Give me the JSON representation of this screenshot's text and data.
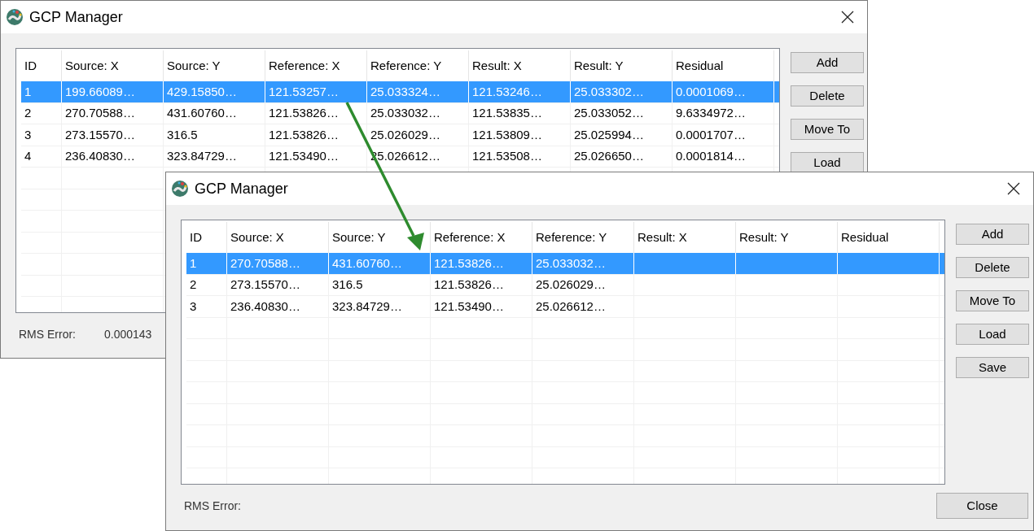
{
  "windows": [
    {
      "title": "GCP Manager",
      "columns": [
        "ID",
        "Source: X",
        "Source: Y",
        "Reference: X",
        "Reference: Y",
        "Result: X",
        "Result: Y",
        "Residual"
      ],
      "rows": [
        {
          "selected": true,
          "cells": [
            "1",
            "199.66089…",
            "429.15850…",
            "121.53257…",
            "25.033324…",
            "121.53246…",
            "25.033302…",
            "0.0001069…"
          ]
        },
        {
          "selected": false,
          "cells": [
            "2",
            "270.70588…",
            "431.60760…",
            "121.53826…",
            "25.033032…",
            "121.53835…",
            "25.033052…",
            "9.6334972…"
          ]
        },
        {
          "selected": false,
          "cells": [
            "3",
            "273.15570…",
            "316.5",
            "121.53826…",
            "25.026029…",
            "121.53809…",
            "25.025994…",
            "0.0001707…"
          ]
        },
        {
          "selected": false,
          "cells": [
            "4",
            "236.40830…",
            "323.84729…",
            "121.53490…",
            "25.026612…",
            "121.53508…",
            "25.026650…",
            "0.0001814…"
          ]
        }
      ],
      "buttons": [
        "Add",
        "Delete",
        "Move To",
        "Load"
      ],
      "rms_label": "RMS Error:",
      "rms_value": "0.000143"
    },
    {
      "title": "GCP Manager",
      "columns": [
        "ID",
        "Source: X",
        "Source: Y",
        "Reference: X",
        "Reference: Y",
        "Result: X",
        "Result: Y",
        "Residual"
      ],
      "rows": [
        {
          "selected": true,
          "cells": [
            "1",
            "270.70588…",
            "431.60760…",
            "121.53826…",
            "25.033032…"
          ]
        },
        {
          "selected": false,
          "cells": [
            "2",
            "273.15570…",
            "316.5",
            "121.53826…",
            "25.026029…"
          ]
        },
        {
          "selected": false,
          "cells": [
            "3",
            "236.40830…",
            "323.84729…",
            "121.53490…",
            "25.026612…"
          ]
        }
      ],
      "buttons": [
        "Add",
        "Delete",
        "Move To",
        "Load",
        "Save"
      ],
      "rms_label": "RMS Error:",
      "close_button": "Close"
    }
  ]
}
